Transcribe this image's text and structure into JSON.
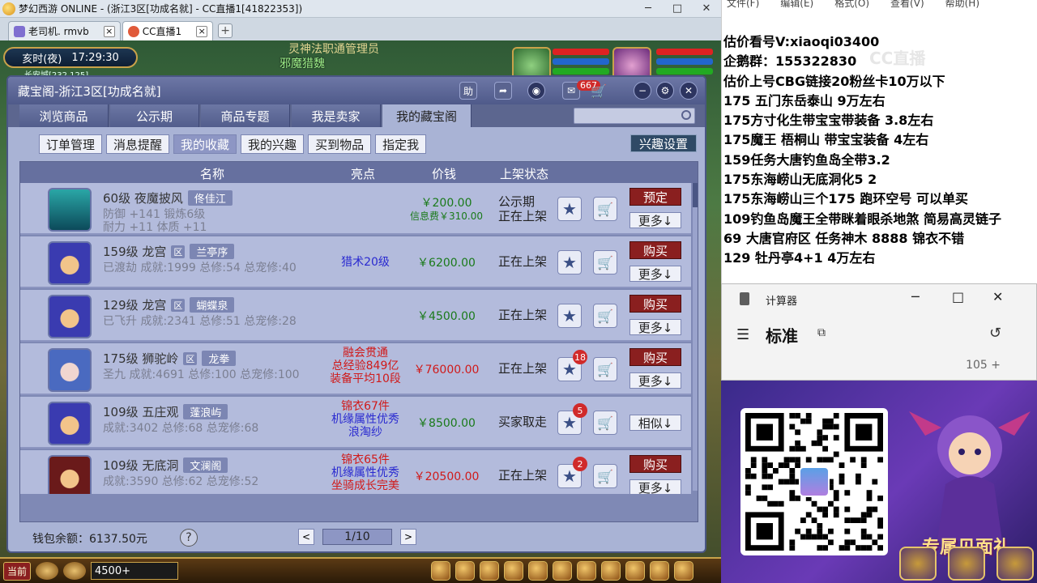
{
  "window": {
    "title": "梦幻西游 ONLINE - (浙江3区[功成名就] - CC直播1[41822353])",
    "controls": [
      "─",
      "□",
      "✕"
    ]
  },
  "browser_tabs": [
    {
      "label": "老司机. rmvb",
      "close": "×"
    },
    {
      "label": "CC直播1",
      "close": "×"
    }
  ],
  "tab_add": "+",
  "game": {
    "clock_period": "亥时(夜)",
    "clock_time": "17:29:30",
    "location": "长安城[232,125]",
    "overlay_text1": "灵神法职通管理员",
    "overlay_text2": "邪魔猎魏"
  },
  "dialog": {
    "title": "藏宝阁-浙江3区[功成名就]",
    "help_btn": "助",
    "cart_badge": "667",
    "nav_tabs": [
      "浏览商品",
      "公示期",
      "商品专题",
      "我是卖家",
      "我的藏宝阁"
    ],
    "sub_tabs": [
      "订单管理",
      "消息提醒",
      "我的收藏",
      "我的兴趣",
      "买到物品",
      "指定我"
    ],
    "interest_btn": "兴趣设置",
    "columns": {
      "name": "名称",
      "highlight": "亮点",
      "price": "价钱",
      "status": "上架状态"
    },
    "rows": [
      {
        "l1": "60级  夜魔披风",
        "tag": "佟佳江",
        "z": "",
        "l2": "防御 +141  锻炼6级",
        "l3": "耐力 +11  体质 +11",
        "hl": [],
        "price": "￥200.00",
        "price_sub": "信息费￥310.00",
        "status": [
          "公示期",
          "正在上架"
        ],
        "count": "",
        "b1": "预定",
        "b2": "更多↓"
      },
      {
        "l1": "159级  龙宫",
        "tag": "兰亭序",
        "z": "区",
        "l2": "已渡劫  成就:1999  总修:54  总宠修:40",
        "l3": "",
        "hl": [
          "猎术20级"
        ],
        "price": "￥6200.00",
        "price_sub": "",
        "status": [
          "正在上架"
        ],
        "count": "",
        "b1": "购买",
        "b2": "更多↓"
      },
      {
        "l1": "129级  龙宫",
        "tag": "蝴蝶泉",
        "z": "区",
        "l2": "已飞升  成就:2341  总修:51  总宠修:28",
        "l3": "",
        "hl": [],
        "price": "￥4500.00",
        "price_sub": "",
        "status": [
          "正在上架"
        ],
        "count": "",
        "b1": "购买",
        "b2": "更多↓"
      },
      {
        "l1": "175级  狮驼岭",
        "tag": "龙拳",
        "z": "区",
        "l2": "圣九  成就:4691  总修:100  总宠修:100",
        "l3": "",
        "hl": [
          "融会贯通",
          "总经验849亿",
          "装备平均10段"
        ],
        "price": "￥76000.00",
        "price_sub": "",
        "status": [
          "正在上架"
        ],
        "count": "18",
        "b1": "购买",
        "b2": "更多↓"
      },
      {
        "l1": "109级  五庄观",
        "tag": "蓬浪屿",
        "z": "",
        "l2": "成就:3402  总修:68  总宠修:68",
        "l3": "",
        "hl": [
          "锦衣67件",
          "机缘属性优秀",
          "浪淘纱"
        ],
        "price": "￥8500.00",
        "price_sub": "",
        "status": [
          "买家取走"
        ],
        "count": "5",
        "b1": "",
        "b2": "相似↓"
      },
      {
        "l1": "109级  无底洞",
        "tag": "文澜阁",
        "z": "",
        "l2": "成就:3590  总修:62  总宠修:52",
        "l3": "",
        "hl": [
          "锦衣65件",
          "机缘属性优秀",
          "坐骑成长完美"
        ],
        "price": "￥20500.00",
        "price_sub": "",
        "status": [
          "正在上架"
        ],
        "count": "2",
        "b1": "购买",
        "b2": "更多↓"
      }
    ],
    "wallet": "钱包余额：6137.50元",
    "help": "?",
    "page": "1/10",
    "prev": "<",
    "next": ">"
  },
  "bottombar": {
    "current": "当前",
    "count": "4500+"
  },
  "notepad": {
    "menu": [
      "文件(F)",
      "编辑(E)",
      "格式(O)",
      "查看(V)",
      "帮助(H)"
    ],
    "lines": [
      "估价看号V:xiaoqi03400",
      "企鹅群：155322830",
      "估价上号CBG链接20粉丝卡10万以下",
      "175 五门东岳泰山  9万左右",
      "175方寸化生带宝宝带装备  3.8左右",
      "175魔王 梧桐山  带宝宝装备 4左右",
      "159任务大唐钓鱼岛全带3.2",
      "175东海崂山无底洞化5  2",
      "175东海崂山三个175 跑环空号 可以单买",
      "109钓鱼岛魔王全带眯着眼杀地煞 简易高灵链子",
      "69  大唐官府区 任务神木 8888 锦衣不错",
      "129 牡丹亭4+1 4万左右"
    ],
    "watermark": "CC直播"
  },
  "calculator": {
    "title": "计算器",
    "mode": "标准",
    "expression": "105 +",
    "controls": [
      "─",
      "□",
      "✕"
    ]
  },
  "promo": {
    "title": "专属见面礼"
  }
}
